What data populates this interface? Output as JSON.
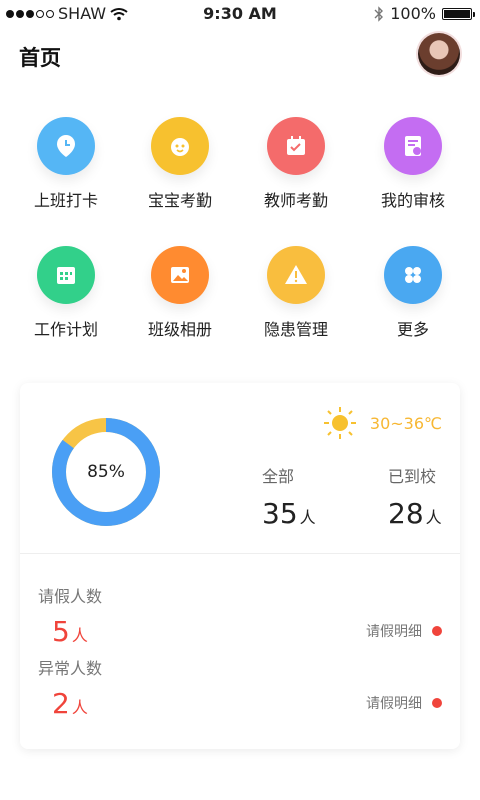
{
  "status_bar": {
    "carrier": "SHAW",
    "time": "9:30 AM",
    "battery": "100%"
  },
  "header": {
    "title": "首页"
  },
  "grid": [
    {
      "label": "上班打卡",
      "icon": "clock-pin-icon",
      "color": "#55b6f5"
    },
    {
      "label": "宝宝考勤",
      "icon": "baby-face-icon",
      "color": "#f7c12f"
    },
    {
      "label": "教师考勤",
      "icon": "calendar-check-icon",
      "color": "#f46b6b"
    },
    {
      "label": "我的审核",
      "icon": "document-review-icon",
      "color": "#c46df2"
    },
    {
      "label": "工作计划",
      "icon": "planner-icon",
      "color": "#32d08a"
    },
    {
      "label": "班级相册",
      "icon": "photo-album-icon",
      "color": "#ff8b30"
    },
    {
      "label": "隐患管理",
      "icon": "warning-icon",
      "color": "#f9be3e"
    },
    {
      "label": "更多",
      "icon": "more-grid-icon",
      "color": "#4aa8f1"
    }
  ],
  "card": {
    "donut_percent_label": "85%",
    "donut_percent": 85,
    "weather": {
      "temp": "30~36℃",
      "icon": "sun-icon"
    },
    "total": {
      "label": "全部",
      "value": "35",
      "unit": "人"
    },
    "arrived": {
      "label": "已到校",
      "value": "28",
      "unit": "人"
    },
    "leave": {
      "label": "请假人数",
      "value": "5",
      "unit": "人",
      "detail": "请假明细"
    },
    "abnormal": {
      "label": "异常人数",
      "value": "2",
      "unit": "人",
      "detail": "请假明细"
    }
  }
}
